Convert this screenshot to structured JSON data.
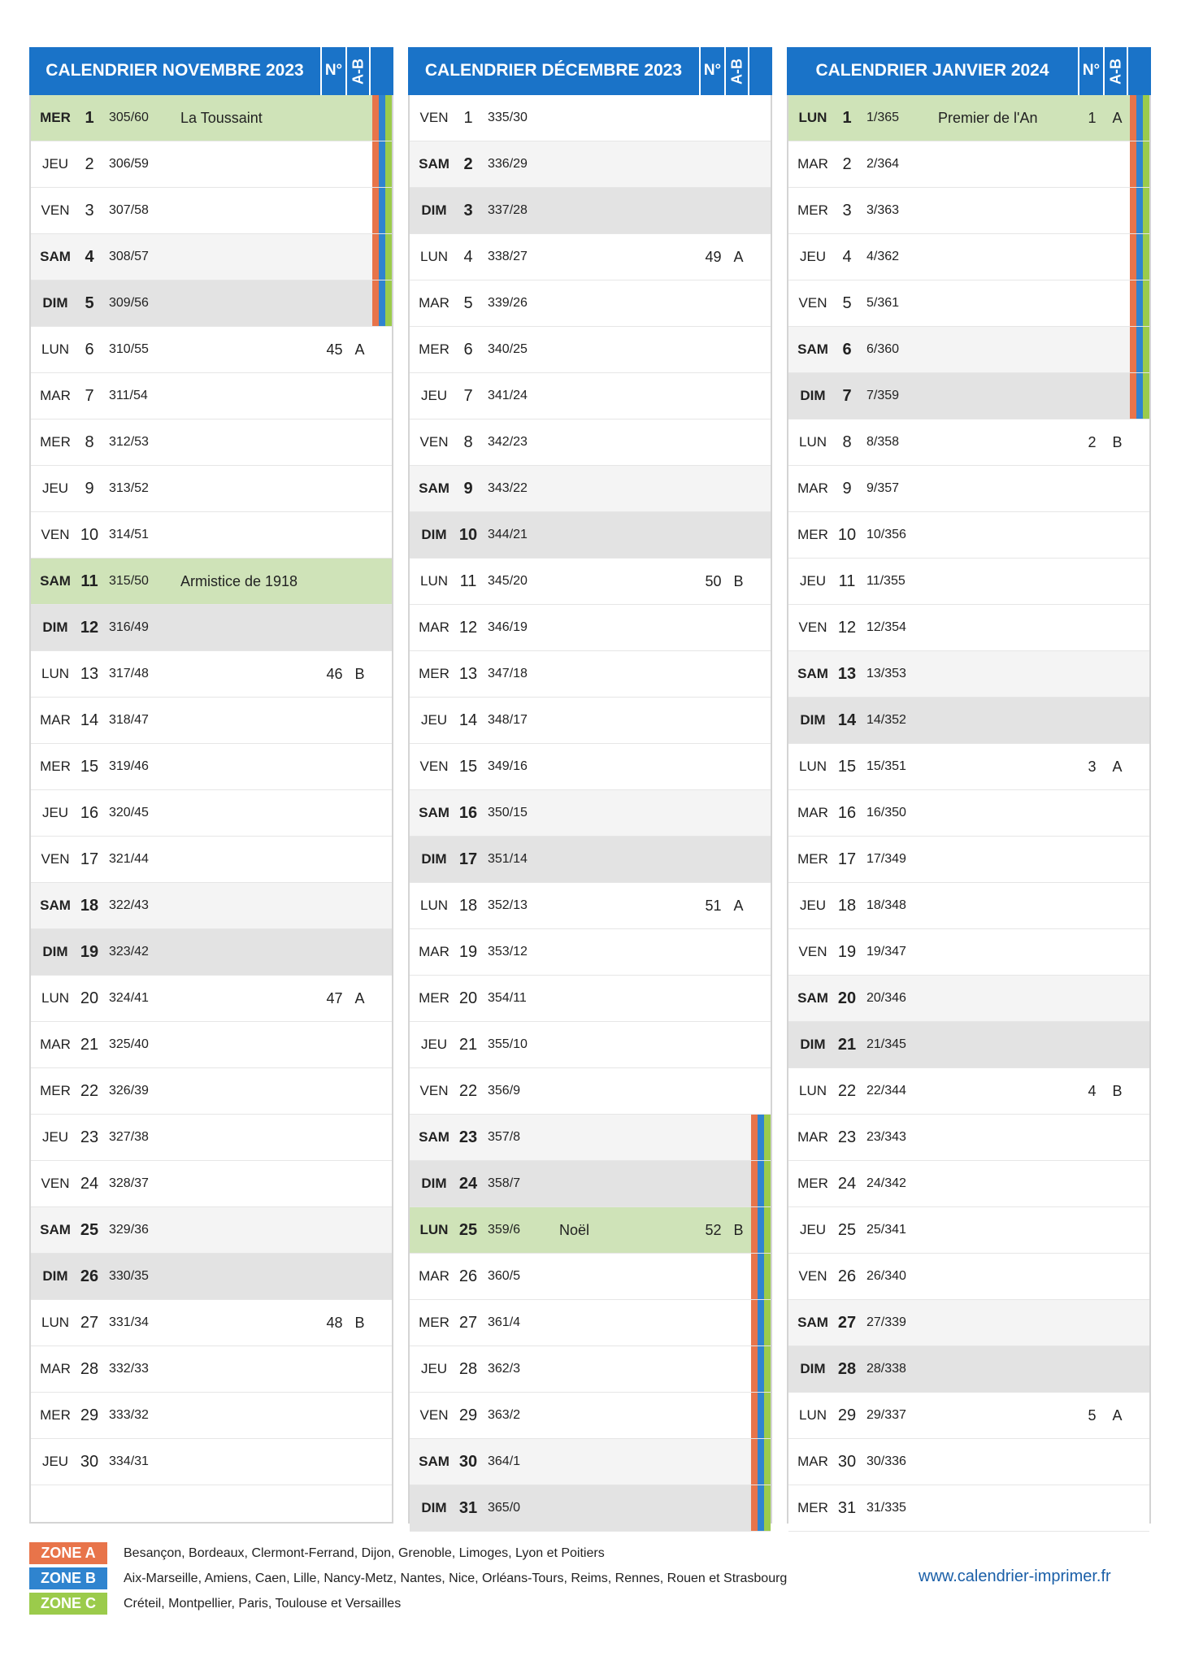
{
  "columns": {
    "no": "N°",
    "ab": "A-B"
  },
  "zones": {
    "a": {
      "badge": "ZONE A",
      "color": "#e8744a",
      "cities": "Besançon, Bordeaux, Clermont-Ferrand, Dijon, Grenoble, Limoges, Lyon et Poitiers"
    },
    "b": {
      "badge": "ZONE B",
      "color": "#2f84cf",
      "cities": "Aix-Marseille, Amiens, Caen, Lille, Nancy-Metz, Nantes, Nice, Orléans-Tours, Reims, Rennes, Rouen et Strasbourg"
    },
    "c": {
      "badge": "ZONE C",
      "color": "#9bcb4b",
      "cities": "Créteil, Montpellier, Paris, Toulouse et Versailles"
    }
  },
  "website": "www.calendrier-imprimer.fr",
  "months": [
    {
      "title": "CALENDRIER NOVEMBRE 2023",
      "days": [
        {
          "wd": "MER",
          "d": "1",
          "yd": "305/60",
          "event": "La Toussaint",
          "zones": "ABC"
        },
        {
          "wd": "JEU",
          "d": "2",
          "yd": "306/59",
          "zones": "ABC"
        },
        {
          "wd": "VEN",
          "d": "3",
          "yd": "307/58",
          "zones": "ABC"
        },
        {
          "wd": "SAM",
          "d": "4",
          "yd": "308/57",
          "zones": "ABC"
        },
        {
          "wd": "DIM",
          "d": "5",
          "yd": "309/56",
          "zones": "ABC"
        },
        {
          "wd": "LUN",
          "d": "6",
          "yd": "310/55",
          "wk": "45",
          "ab": "A"
        },
        {
          "wd": "MAR",
          "d": "7",
          "yd": "311/54"
        },
        {
          "wd": "MER",
          "d": "8",
          "yd": "312/53"
        },
        {
          "wd": "JEU",
          "d": "9",
          "yd": "313/52"
        },
        {
          "wd": "VEN",
          "d": "10",
          "yd": "314/51"
        },
        {
          "wd": "SAM",
          "d": "11",
          "yd": "315/50",
          "event": "Armistice de 1918"
        },
        {
          "wd": "DIM",
          "d": "12",
          "yd": "316/49"
        },
        {
          "wd": "LUN",
          "d": "13",
          "yd": "317/48",
          "wk": "46",
          "ab": "B"
        },
        {
          "wd": "MAR",
          "d": "14",
          "yd": "318/47"
        },
        {
          "wd": "MER",
          "d": "15",
          "yd": "319/46"
        },
        {
          "wd": "JEU",
          "d": "16",
          "yd": "320/45"
        },
        {
          "wd": "VEN",
          "d": "17",
          "yd": "321/44"
        },
        {
          "wd": "SAM",
          "d": "18",
          "yd": "322/43"
        },
        {
          "wd": "DIM",
          "d": "19",
          "yd": "323/42"
        },
        {
          "wd": "LUN",
          "d": "20",
          "yd": "324/41",
          "wk": "47",
          "ab": "A"
        },
        {
          "wd": "MAR",
          "d": "21",
          "yd": "325/40"
        },
        {
          "wd": "MER",
          "d": "22",
          "yd": "326/39"
        },
        {
          "wd": "JEU",
          "d": "23",
          "yd": "327/38"
        },
        {
          "wd": "VEN",
          "d": "24",
          "yd": "328/37"
        },
        {
          "wd": "SAM",
          "d": "25",
          "yd": "329/36"
        },
        {
          "wd": "DIM",
          "d": "26",
          "yd": "330/35"
        },
        {
          "wd": "LUN",
          "d": "27",
          "yd": "331/34",
          "wk": "48",
          "ab": "B"
        },
        {
          "wd": "MAR",
          "d": "28",
          "yd": "332/33"
        },
        {
          "wd": "MER",
          "d": "29",
          "yd": "333/32"
        },
        {
          "wd": "JEU",
          "d": "30",
          "yd": "334/31"
        }
      ]
    },
    {
      "title": "CALENDRIER DÉCEMBRE 2023",
      "days": [
        {
          "wd": "VEN",
          "d": "1",
          "yd": "335/30"
        },
        {
          "wd": "SAM",
          "d": "2",
          "yd": "336/29"
        },
        {
          "wd": "DIM",
          "d": "3",
          "yd": "337/28"
        },
        {
          "wd": "LUN",
          "d": "4",
          "yd": "338/27",
          "wk": "49",
          "ab": "A"
        },
        {
          "wd": "MAR",
          "d": "5",
          "yd": "339/26"
        },
        {
          "wd": "MER",
          "d": "6",
          "yd": "340/25"
        },
        {
          "wd": "JEU",
          "d": "7",
          "yd": "341/24"
        },
        {
          "wd": "VEN",
          "d": "8",
          "yd": "342/23"
        },
        {
          "wd": "SAM",
          "d": "9",
          "yd": "343/22"
        },
        {
          "wd": "DIM",
          "d": "10",
          "yd": "344/21"
        },
        {
          "wd": "LUN",
          "d": "11",
          "yd": "345/20",
          "wk": "50",
          "ab": "B"
        },
        {
          "wd": "MAR",
          "d": "12",
          "yd": "346/19"
        },
        {
          "wd": "MER",
          "d": "13",
          "yd": "347/18"
        },
        {
          "wd": "JEU",
          "d": "14",
          "yd": "348/17"
        },
        {
          "wd": "VEN",
          "d": "15",
          "yd": "349/16"
        },
        {
          "wd": "SAM",
          "d": "16",
          "yd": "350/15"
        },
        {
          "wd": "DIM",
          "d": "17",
          "yd": "351/14"
        },
        {
          "wd": "LUN",
          "d": "18",
          "yd": "352/13",
          "wk": "51",
          "ab": "A"
        },
        {
          "wd": "MAR",
          "d": "19",
          "yd": "353/12"
        },
        {
          "wd": "MER",
          "d": "20",
          "yd": "354/11"
        },
        {
          "wd": "JEU",
          "d": "21",
          "yd": "355/10"
        },
        {
          "wd": "VEN",
          "d": "22",
          "yd": "356/9"
        },
        {
          "wd": "SAM",
          "d": "23",
          "yd": "357/8",
          "zones": "ABC"
        },
        {
          "wd": "DIM",
          "d": "24",
          "yd": "358/7",
          "zones": "ABC"
        },
        {
          "wd": "LUN",
          "d": "25",
          "yd": "359/6",
          "event": "Noël",
          "wk": "52",
          "ab": "B",
          "zones": "ABC"
        },
        {
          "wd": "MAR",
          "d": "26",
          "yd": "360/5",
          "zones": "ABC"
        },
        {
          "wd": "MER",
          "d": "27",
          "yd": "361/4",
          "zones": "ABC"
        },
        {
          "wd": "JEU",
          "d": "28",
          "yd": "362/3",
          "zones": "ABC"
        },
        {
          "wd": "VEN",
          "d": "29",
          "yd": "363/2",
          "zones": "ABC"
        },
        {
          "wd": "SAM",
          "d": "30",
          "yd": "364/1",
          "zones": "ABC"
        },
        {
          "wd": "DIM",
          "d": "31",
          "yd": "365/0",
          "zones": "ABC"
        }
      ]
    },
    {
      "title": "CALENDRIER JANVIER 2024",
      "days": [
        {
          "wd": "LUN",
          "d": "1",
          "yd": "1/365",
          "event": "Premier de l'An",
          "wk": "1",
          "ab": "A",
          "zones": "ABC"
        },
        {
          "wd": "MAR",
          "d": "2",
          "yd": "2/364",
          "zones": "ABC"
        },
        {
          "wd": "MER",
          "d": "3",
          "yd": "3/363",
          "zones": "ABC"
        },
        {
          "wd": "JEU",
          "d": "4",
          "yd": "4/362",
          "zones": "ABC"
        },
        {
          "wd": "VEN",
          "d": "5",
          "yd": "5/361",
          "zones": "ABC"
        },
        {
          "wd": "SAM",
          "d": "6",
          "yd": "6/360",
          "zones": "ABC"
        },
        {
          "wd": "DIM",
          "d": "7",
          "yd": "7/359",
          "zones": "ABC"
        },
        {
          "wd": "LUN",
          "d": "8",
          "yd": "8/358",
          "wk": "2",
          "ab": "B"
        },
        {
          "wd": "MAR",
          "d": "9",
          "yd": "9/357"
        },
        {
          "wd": "MER",
          "d": "10",
          "yd": "10/356"
        },
        {
          "wd": "JEU",
          "d": "11",
          "yd": "11/355"
        },
        {
          "wd": "VEN",
          "d": "12",
          "yd": "12/354"
        },
        {
          "wd": "SAM",
          "d": "13",
          "yd": "13/353"
        },
        {
          "wd": "DIM",
          "d": "14",
          "yd": "14/352"
        },
        {
          "wd": "LUN",
          "d": "15",
          "yd": "15/351",
          "wk": "3",
          "ab": "A"
        },
        {
          "wd": "MAR",
          "d": "16",
          "yd": "16/350"
        },
        {
          "wd": "MER",
          "d": "17",
          "yd": "17/349"
        },
        {
          "wd": "JEU",
          "d": "18",
          "yd": "18/348"
        },
        {
          "wd": "VEN",
          "d": "19",
          "yd": "19/347"
        },
        {
          "wd": "SAM",
          "d": "20",
          "yd": "20/346"
        },
        {
          "wd": "DIM",
          "d": "21",
          "yd": "21/345"
        },
        {
          "wd": "LUN",
          "d": "22",
          "yd": "22/344",
          "wk": "4",
          "ab": "B"
        },
        {
          "wd": "MAR",
          "d": "23",
          "yd": "23/343"
        },
        {
          "wd": "MER",
          "d": "24",
          "yd": "24/342"
        },
        {
          "wd": "JEU",
          "d": "25",
          "yd": "25/341"
        },
        {
          "wd": "VEN",
          "d": "26",
          "yd": "26/340"
        },
        {
          "wd": "SAM",
          "d": "27",
          "yd": "27/339"
        },
        {
          "wd": "DIM",
          "d": "28",
          "yd": "28/338"
        },
        {
          "wd": "LUN",
          "d": "29",
          "yd": "29/337",
          "wk": "5",
          "ab": "A"
        },
        {
          "wd": "MAR",
          "d": "30",
          "yd": "30/336"
        },
        {
          "wd": "MER",
          "d": "31",
          "yd": "31/335"
        }
      ]
    }
  ]
}
